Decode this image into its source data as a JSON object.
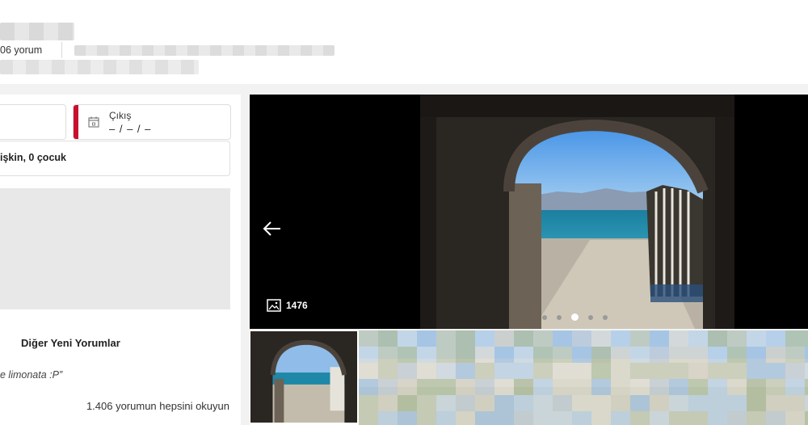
{
  "header": {
    "reviews_count": "06 yorum"
  },
  "booking": {
    "checkout_label": "Çıkış",
    "checkout_value": "– / – / –",
    "guests_summary": "işkin, 0 çocuk"
  },
  "reviews": {
    "other_title": "Diğer Yeni Yorumlar",
    "snippet": "e limonata :P”",
    "read_all": "1.406 yorumun hepsini okuyun"
  },
  "gallery": {
    "photo_count": "1476",
    "dots_total": 5,
    "active_dot": 3
  },
  "icons": {
    "calendar": "calendar-icon",
    "prev": "arrow-left-icon",
    "photos": "image-icon"
  },
  "colors": {
    "accent_red": "#c8102e"
  }
}
